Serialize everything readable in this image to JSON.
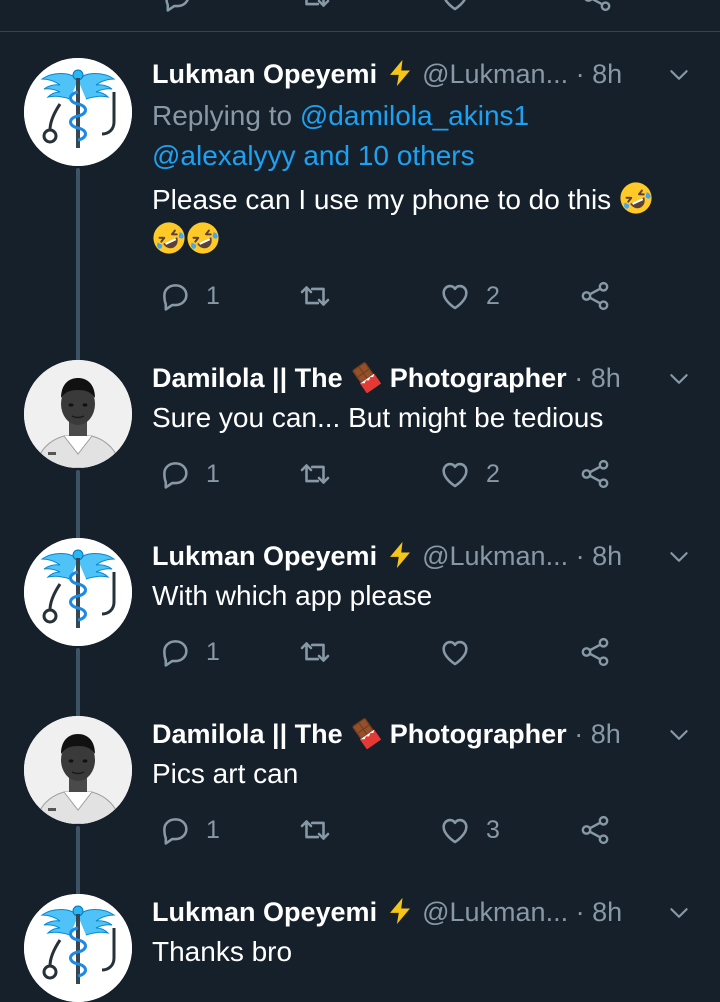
{
  "colors": {
    "background": "#15202b",
    "accent": "#1da1f2",
    "muted": "#8899a6",
    "divider": "#38444d",
    "thread_line": "#3d5466"
  },
  "icons": {
    "reply": "reply-icon",
    "retweet": "retweet-icon",
    "like": "heart-icon",
    "share": "share-icon",
    "more": "chevron-down-icon",
    "lightning": "lightning-emoji",
    "chocolate": "chocolate-emoji",
    "laugh": "rofl-emoji"
  },
  "tweets": [
    {
      "name": "Lukman Opeyemi",
      "handle": "@Lukman...",
      "dot": "·",
      "time": "8h",
      "replying_prefix": "Replying to ",
      "replying_first": "@damilola_akins1",
      "replying_second": "@alexalyyy and 10 others",
      "text": "Please can I use my phone to do this",
      "replies": "1",
      "retweets": "",
      "likes": "2"
    },
    {
      "name_part1": "Damilola || The",
      "name_part2": "Photographer",
      "dot": "·",
      "time": "8h",
      "text": "Sure you can... But might be tedious",
      "replies": "1",
      "retweets": "",
      "likes": "2"
    },
    {
      "name": "Lukman Opeyemi",
      "handle": "@Lukman...",
      "dot": "·",
      "time": "8h",
      "text": "With which app please",
      "replies": "1",
      "retweets": "",
      "likes": ""
    },
    {
      "name_part1": "Damilola || The",
      "name_part2": "Photographer",
      "dot": "·",
      "time": "8h",
      "text": "Pics art can",
      "replies": "1",
      "retweets": "",
      "likes": "3"
    },
    {
      "name": "Lukman Opeyemi",
      "handle": "@Lukman...",
      "dot": "·",
      "time": "8h",
      "text": "Thanks bro"
    }
  ]
}
